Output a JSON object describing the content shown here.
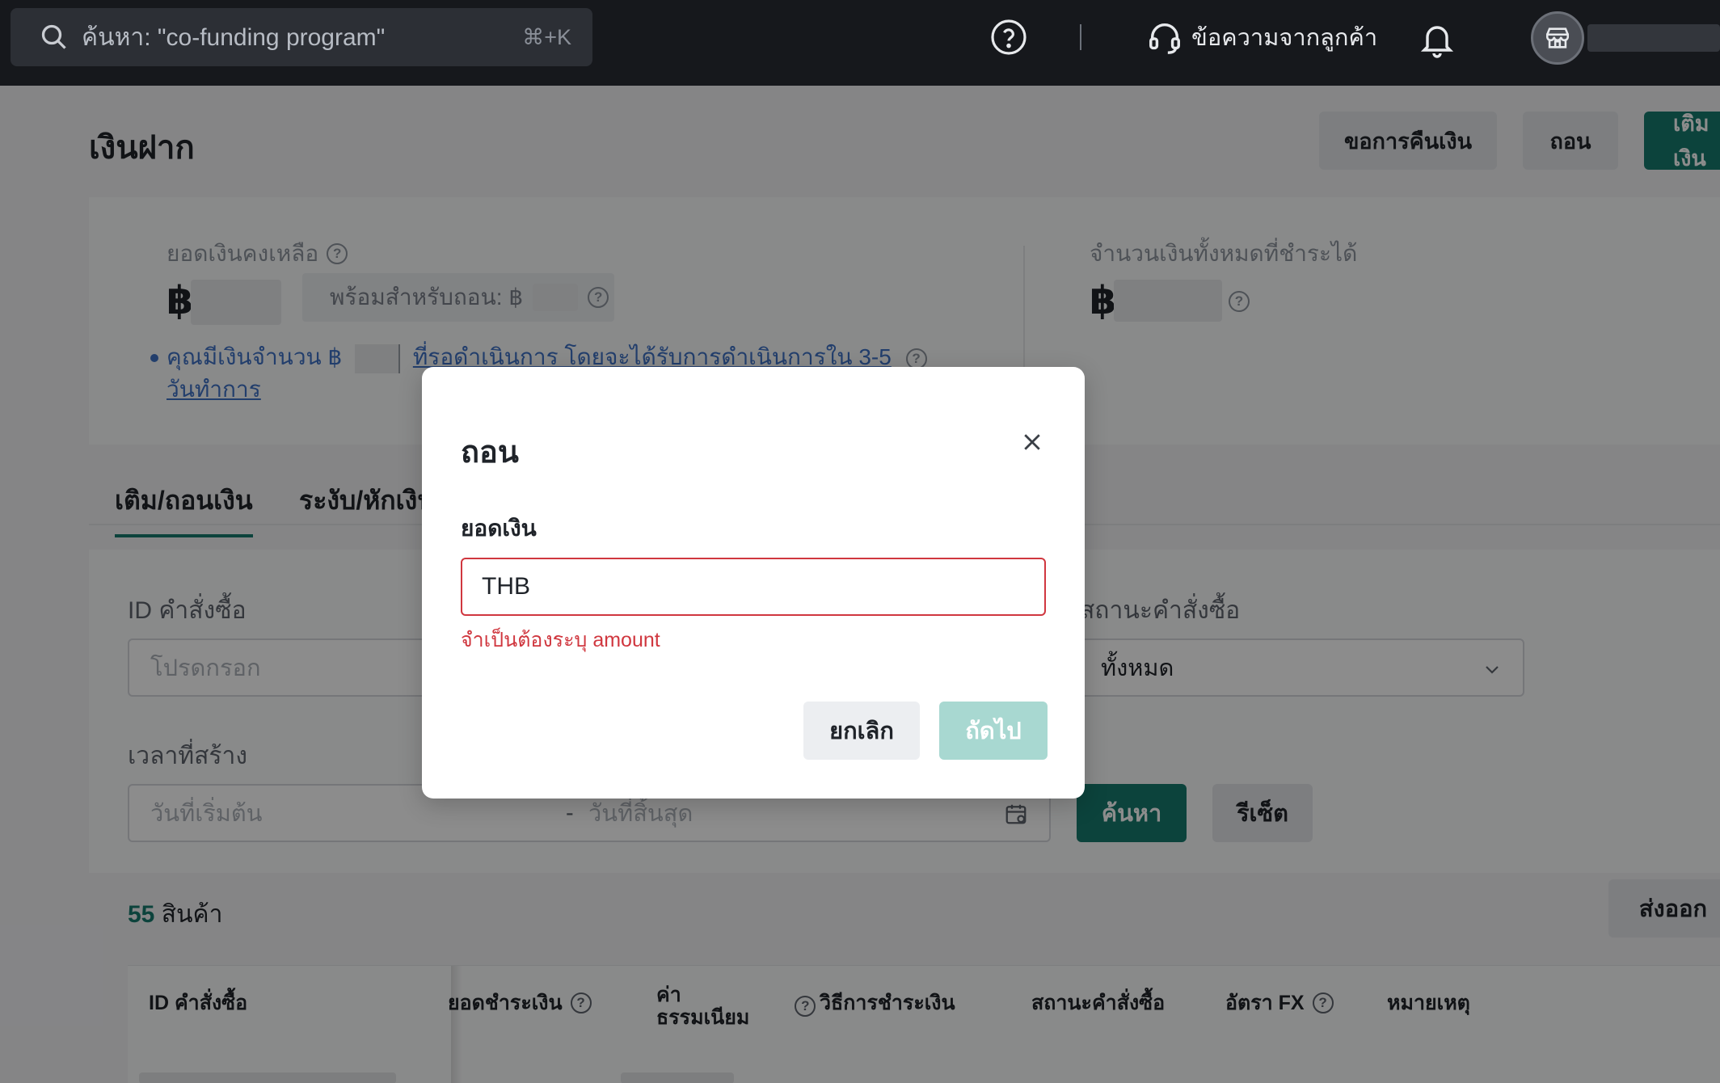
{
  "topbar": {
    "search_placeholder": "ค้นหา: \"co-funding program\"",
    "search_shortcut": "⌘+K",
    "customer_messages_label": "ข้อความจากลูกค้า"
  },
  "page": {
    "title": "เงินฝาก",
    "buttons": {
      "refund": "ขอการคืนเงิน",
      "withdraw": "ถอน",
      "topup": "เติมเงิน"
    }
  },
  "balance": {
    "balance_label": "ยอดเงินคงเหลือ",
    "currency_symbol": "฿",
    "available_label": "พร้อมสำหรับถอน: ฿",
    "pending_prefix": "คุณมีเงินจำนวน ฿",
    "pending_suffix": "ที่รอดำเนินการ โดยจะได้รับการดำเนินการใน 3-5",
    "pending_line2": "วันทำการ",
    "payable_label": "จำนวนเงินทั้งหมดที่ชำระได้"
  },
  "tabs": [
    {
      "label": "เติม/ถอนเงิน",
      "active": true
    },
    {
      "label": "ระงับ/หักเงิน",
      "active": false
    }
  ],
  "filters": {
    "order_id_label": "ID คำสั่งซื้อ",
    "order_id_placeholder": "โปรดกรอก",
    "status_label": "สถานะคำสั่งซื้อ",
    "status_value": "ทั้งหมด",
    "created_label": "เวลาที่สร้าง",
    "start_placeholder": "วันที่เริ่มต้น",
    "date_separator": "-",
    "end_placeholder": "วันที่สิ้นสุด",
    "search_button": "ค้นหา",
    "reset_button": "รีเซ็ต"
  },
  "results": {
    "count": "55",
    "count_unit": "สินค้า",
    "export_button": "ส่งออก"
  },
  "table": {
    "headers": [
      "ID คำสั่งซื้อ",
      "ยอดชำระเงิน",
      "ค่า",
      "ธรรมเนียม",
      "วิธีการชำระเงิน",
      "สถานะคำสั่งซื้อ",
      "อัตรา FX",
      "หมายเหตุ"
    ]
  },
  "modal": {
    "title": "ถอน",
    "amount_label": "ยอดเงิน",
    "amount_value": "THB",
    "error": "จำเป็นต้องระบุ amount",
    "cancel_button": "ยกเลิก",
    "next_button": "ถัดไป"
  },
  "colors": {
    "accent": "#167a6d",
    "error": "#d0373f",
    "link": "#3f72c5",
    "disabled_primary": "#a8d8d1"
  }
}
